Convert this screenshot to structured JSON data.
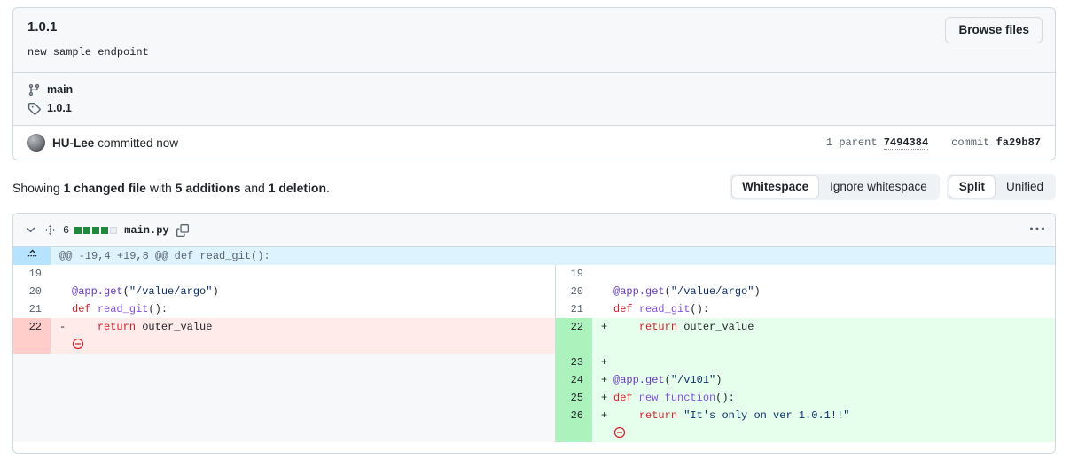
{
  "commit": {
    "title": "1.0.1",
    "description": "new sample endpoint",
    "browse_files_label": "Browse files",
    "branch_icon": "git-branch-icon",
    "branch": "main",
    "tag_icon": "tag-icon",
    "tag": "1.0.1",
    "author": "HU-Lee",
    "committed_text": "committed now",
    "parent_count_label": "1 parent",
    "parent_sha": "7494384",
    "commit_label": "commit",
    "commit_sha": "fa29b87"
  },
  "summary": {
    "prefix": "Showing ",
    "changed_files": "1 changed file",
    "mid": " with ",
    "additions": "5 additions",
    "and": " and ",
    "deletions": "1 deletion",
    "suffix": "."
  },
  "controls": {
    "whitespace_group": [
      {
        "label": "Whitespace",
        "selected": true
      },
      {
        "label": "Ignore whitespace",
        "selected": false
      }
    ],
    "view_group": [
      {
        "label": "Split",
        "selected": true
      },
      {
        "label": "Unified",
        "selected": false
      }
    ]
  },
  "file": {
    "collapse_icon": "chevron-down-icon",
    "drag_icon": "move-icon",
    "change_count": "6",
    "diffstat_blocks": [
      "add",
      "add",
      "add",
      "add",
      "neutral"
    ],
    "name": "main.py",
    "copy_icon": "copy-icon",
    "menu_icon": "kebab-horizontal-icon"
  },
  "diff": {
    "expand_icon": "unfold-up-icon",
    "hunk_header": "@@ -19,4 +19,8 @@ def read_git():",
    "rows": [
      {
        "type": "context",
        "left_num": "19",
        "left_marker": "",
        "left_code": [],
        "right_num": "19",
        "right_marker": "",
        "right_code": []
      },
      {
        "type": "context",
        "left_num": "20",
        "left_marker": "",
        "left_code": [
          {
            "t": "@app.get",
            "c": "dec"
          },
          {
            "t": "(",
            "c": "plain"
          },
          {
            "t": "\"/value/argo\"",
            "c": "str"
          },
          {
            "t": ")",
            "c": "plain"
          }
        ],
        "right_num": "20",
        "right_marker": "",
        "right_code": [
          {
            "t": "@app.get",
            "c": "dec"
          },
          {
            "t": "(",
            "c": "plain"
          },
          {
            "t": "\"/value/argo\"",
            "c": "str"
          },
          {
            "t": ")",
            "c": "plain"
          }
        ]
      },
      {
        "type": "context",
        "left_num": "21",
        "left_marker": "",
        "left_code": [
          {
            "t": "def ",
            "c": "kw"
          },
          {
            "t": "read_git",
            "c": "fn"
          },
          {
            "t": "():",
            "c": "plain"
          }
        ],
        "right_num": "21",
        "right_marker": "",
        "right_code": [
          {
            "t": "def ",
            "c": "kw"
          },
          {
            "t": "read_git",
            "c": "fn"
          },
          {
            "t": "():",
            "c": "plain"
          }
        ]
      },
      {
        "type": "change",
        "left_num": "22",
        "left_marker": "-",
        "left_code": [
          {
            "t": "    ",
            "c": "plain"
          },
          {
            "t": "return",
            "c": "kw"
          },
          {
            "t": " outer_value",
            "c": "plain"
          }
        ],
        "right_num": "22",
        "right_marker": "+",
        "right_code": [
          {
            "t": "    ",
            "c": "plain"
          },
          {
            "t": "return",
            "c": "kw"
          },
          {
            "t": " outer_value",
            "c": "plain"
          }
        ]
      },
      {
        "type": "nonewline-left",
        "left_num": "",
        "left_marker": "",
        "left_code": [],
        "left_nonewline": true,
        "right_num": "",
        "right_marker": "",
        "right_code": [],
        "right_blank": true
      },
      {
        "type": "add",
        "left_blank": true,
        "left_num": "",
        "left_marker": "",
        "left_code": [],
        "right_num": "23",
        "right_marker": "+",
        "right_code": []
      },
      {
        "type": "add",
        "left_blank": true,
        "left_num": "",
        "left_marker": "",
        "left_code": [],
        "right_num": "24",
        "right_marker": "+",
        "right_code": [
          {
            "t": "@app.get",
            "c": "dec"
          },
          {
            "t": "(",
            "c": "plain"
          },
          {
            "t": "\"/v101\"",
            "c": "str"
          },
          {
            "t": ")",
            "c": "plain"
          }
        ]
      },
      {
        "type": "add",
        "left_blank": true,
        "left_num": "",
        "left_marker": "",
        "left_code": [],
        "right_num": "25",
        "right_marker": "+",
        "right_code": [
          {
            "t": "def ",
            "c": "kw"
          },
          {
            "t": "new_function",
            "c": "fn"
          },
          {
            "t": "():",
            "c": "plain"
          }
        ]
      },
      {
        "type": "add",
        "left_blank": true,
        "left_num": "",
        "left_marker": "",
        "left_code": [],
        "right_num": "26",
        "right_marker": "+",
        "right_code": [
          {
            "t": "    ",
            "c": "plain"
          },
          {
            "t": "return",
            "c": "kw"
          },
          {
            "t": " ",
            "c": "plain"
          },
          {
            "t": "\"It's only on ver 1.0.1!!\"",
            "c": "str"
          }
        ]
      },
      {
        "type": "nonewline-right",
        "left_blank": true,
        "left_num": "",
        "left_marker": "",
        "left_code": [],
        "right_num": "",
        "right_marker": "",
        "right_code": [],
        "right_nonewline": true
      }
    ]
  },
  "colors": {
    "addition_bg": "#e6ffec",
    "addition_num_bg": "#abf2bc",
    "deletion_bg": "#ffebe9",
    "deletion_num_bg": "#ffcecb",
    "hunk_bg": "#ddf4ff",
    "border": "#d1d9e0",
    "canvas_subtle": "#f6f8fa",
    "diffstat_green": "#1f883d",
    "nonewline_red": "#cf222e"
  }
}
